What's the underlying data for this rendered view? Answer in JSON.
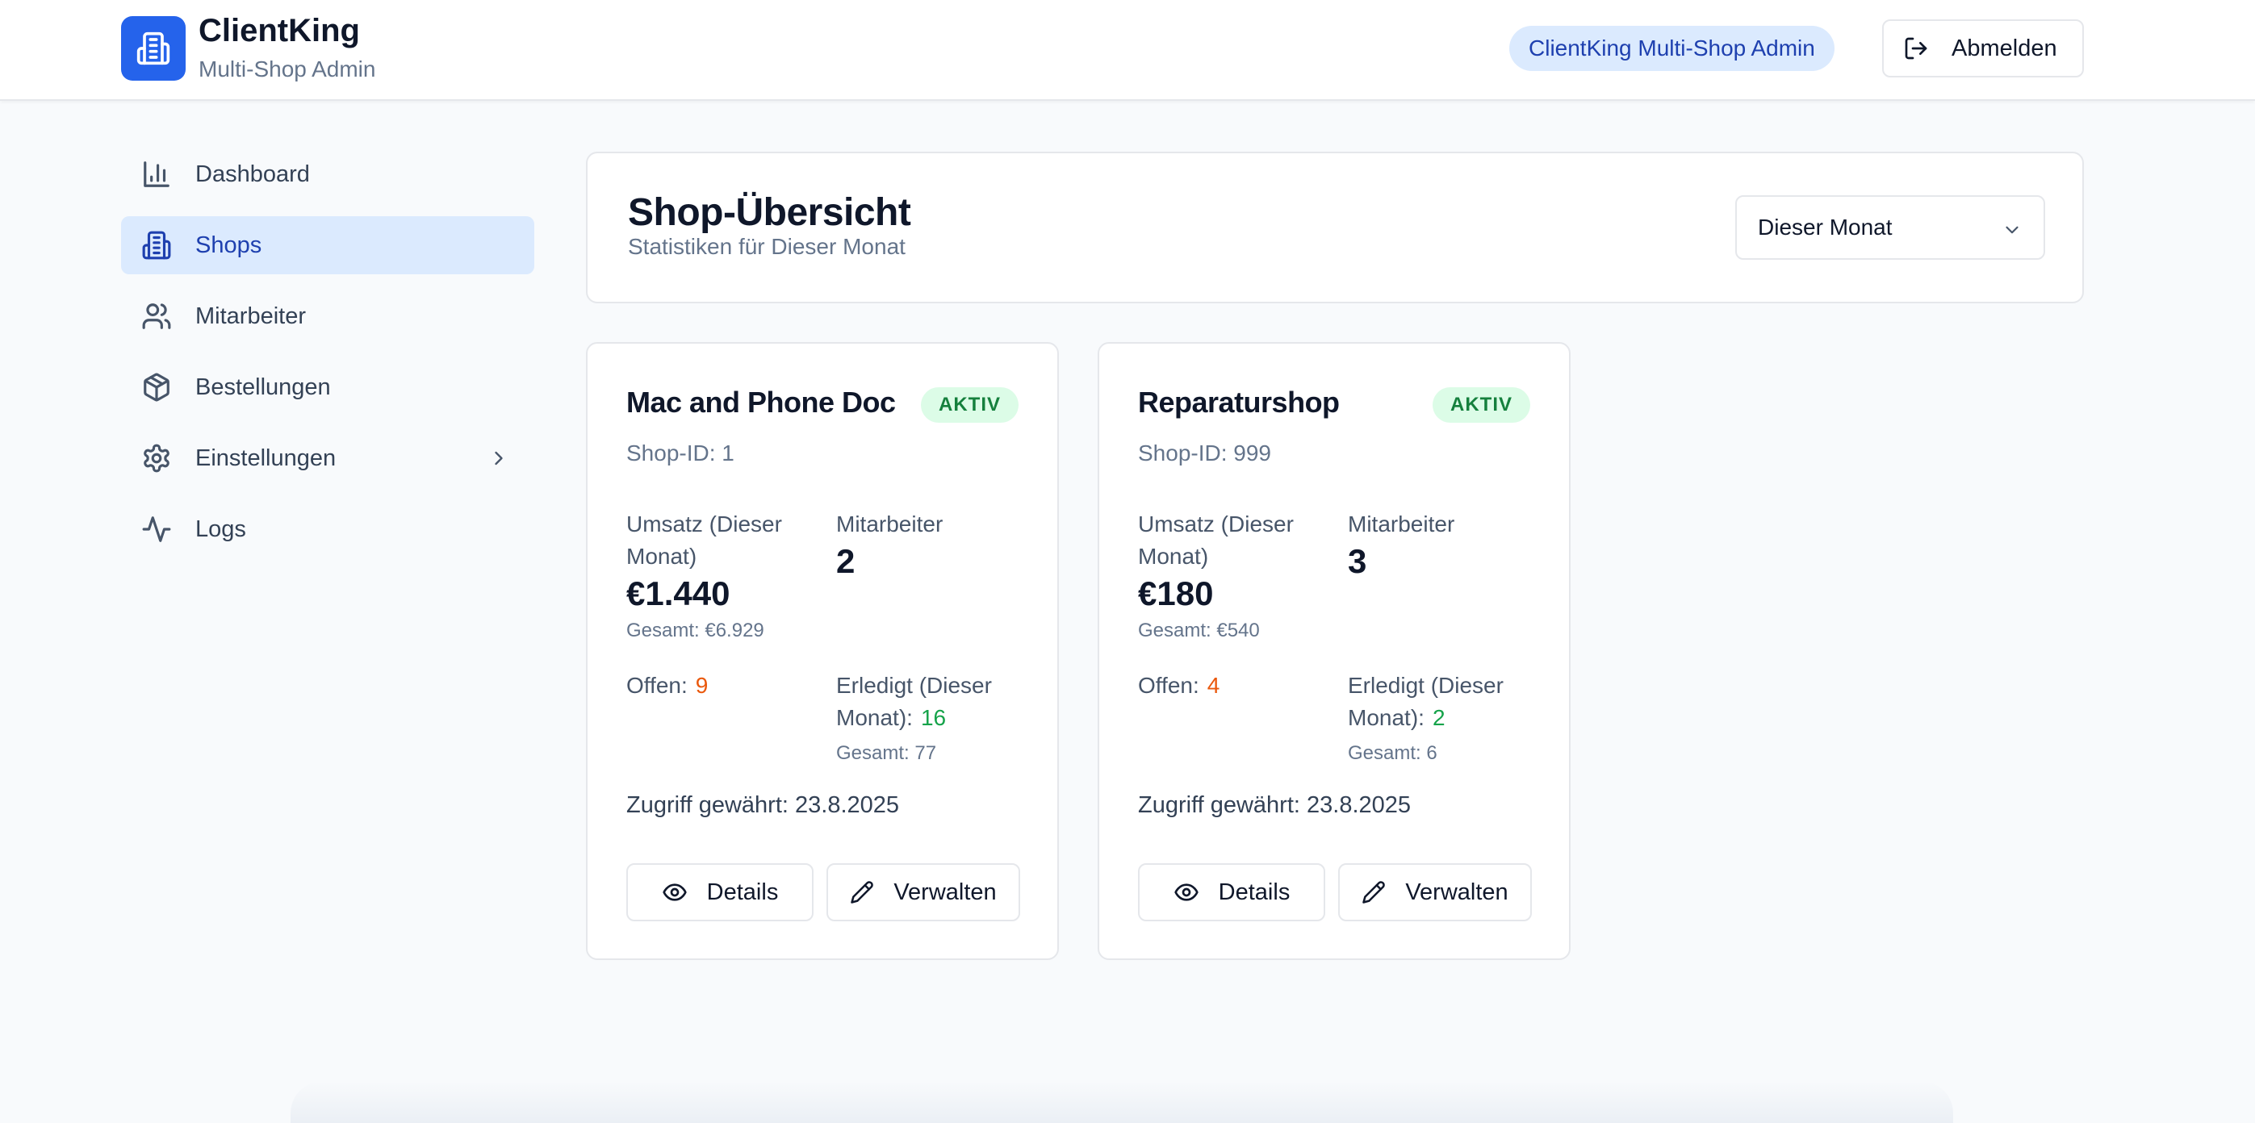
{
  "app": {
    "name": "ClientKing",
    "subtitle": "Multi-Shop Admin",
    "role_badge": "ClientKing Multi-Shop Admin",
    "logout_label": "Abmelden"
  },
  "sidebar": {
    "items": [
      {
        "label": "Dashboard",
        "icon": "bar-chart-icon",
        "active": false
      },
      {
        "label": "Shops",
        "icon": "building-icon",
        "active": true
      },
      {
        "label": "Mitarbeiter",
        "icon": "users-icon",
        "active": false
      },
      {
        "label": "Bestellungen",
        "icon": "package-icon",
        "active": false
      },
      {
        "label": "Einstellungen",
        "icon": "gear-icon",
        "active": false,
        "has_submenu": true
      },
      {
        "label": "Logs",
        "icon": "activity-icon",
        "active": false
      }
    ]
  },
  "overview": {
    "title": "Shop-Übersicht",
    "subtitle": "Statistiken für Dieser Monat",
    "period_select": "Dieser Monat"
  },
  "shops": [
    {
      "name": "Mac and Phone Doc",
      "status": "AKTIV",
      "shop_id": "Shop-ID: 1",
      "revenue_label": "Umsatz (Dieser Monat)",
      "revenue": "€1.440",
      "revenue_total": "Gesamt: €6.929",
      "employees_label": "Mitarbeiter",
      "employees": "2",
      "open_label": "Offen:",
      "open": "9",
      "done_label": "Erledigt (Dieser Monat):",
      "done": "16",
      "done_total": "Gesamt: 77",
      "access": "Zugriff gewährt: 23.8.2025",
      "details_label": "Details",
      "manage_label": "Verwalten"
    },
    {
      "name": "Reparaturshop",
      "status": "AKTIV",
      "shop_id": "Shop-ID: 999",
      "revenue_label": "Umsatz (Dieser Monat)",
      "revenue": "€180",
      "revenue_total": "Gesamt: €540",
      "employees_label": "Mitarbeiter",
      "employees": "3",
      "open_label": "Offen:",
      "open": "4",
      "done_label": "Erledigt (Dieser Monat):",
      "done": "2",
      "done_total": "Gesamt: 6",
      "access": "Zugriff gewährt: 23.8.2025",
      "details_label": "Details",
      "manage_label": "Verwalten"
    }
  ],
  "colors": {
    "accent": "#2563eb",
    "active_bg": "#dbeafe",
    "active_text": "#1e40af",
    "status_green_bg": "#dcfce7",
    "status_green_text": "#15803d",
    "open_orange": "#ea580c",
    "done_green": "#16a34a"
  }
}
